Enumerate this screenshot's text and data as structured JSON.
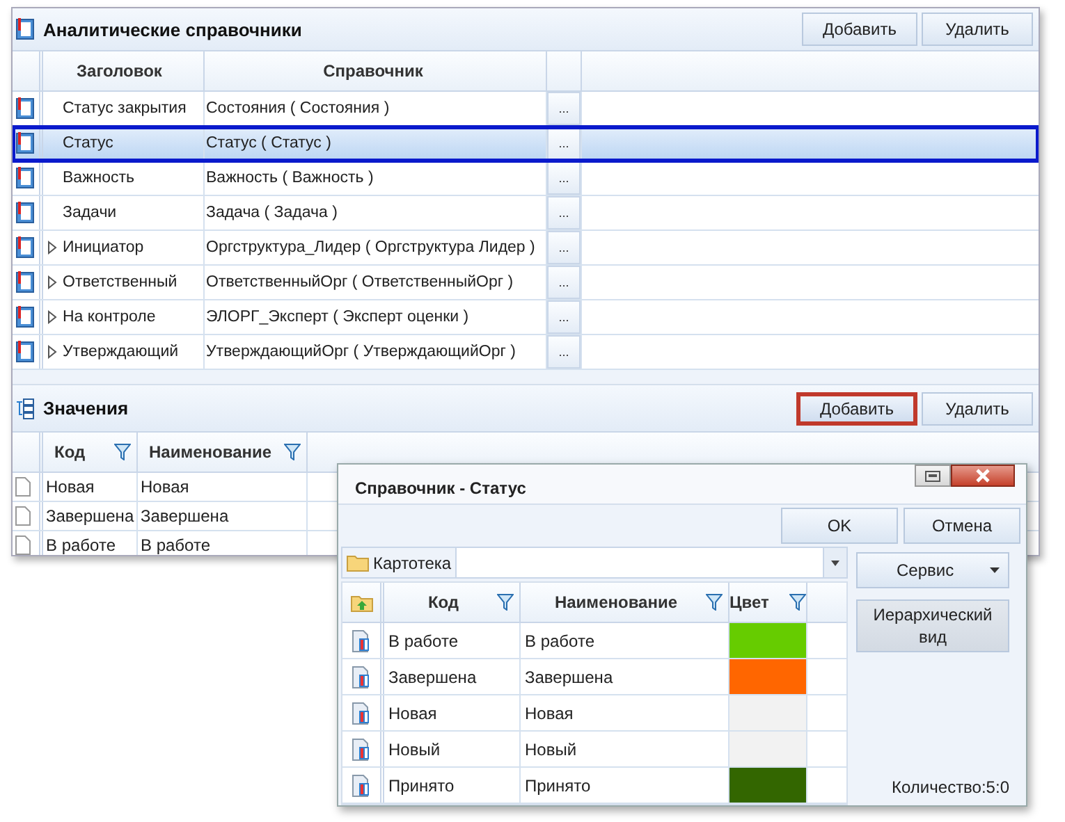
{
  "main_panel": {
    "title": "Аналитические справочники",
    "buttons": [
      "Добавить",
      "Удалить"
    ],
    "columns": [
      "Заголовок",
      "Справочник"
    ],
    "rows": [
      {
        "title": "Статус закрытия",
        "reference": "Состояния ( Состояния )",
        "button": "...",
        "expandable": false,
        "selected": false
      },
      {
        "title": "Статус",
        "reference": "Статус ( Статус )",
        "button": "...",
        "expandable": false,
        "selected": true
      },
      {
        "title": "Важность",
        "reference": "Важность ( Важность )",
        "button": "...",
        "expandable": false,
        "selected": false
      },
      {
        "title": "Задачи",
        "reference": "Задача ( Задача )",
        "button": "...",
        "expandable": false,
        "selected": false
      },
      {
        "title": "Инициатор",
        "reference": "Оргструктура_Лидер ( Оргструктура Лидер )",
        "button": "...",
        "expandable": true,
        "selected": false
      },
      {
        "title": "Ответственный",
        "reference": "ОтветственныйОрг ( ОтветственныйОрг )",
        "button": "...",
        "expandable": true,
        "selected": false
      },
      {
        "title": "На контроле",
        "reference": "ЭЛОРГ_Эксперт ( Эксперт оценки )",
        "button": "...",
        "expandable": true,
        "selected": false
      },
      {
        "title": "Утверждающий",
        "reference": "УтверждающийОрг ( УтверждающийОрг )",
        "button": "...",
        "expandable": true,
        "selected": false
      }
    ]
  },
  "values_panel": {
    "title": "Значения",
    "buttons": [
      {
        "label": "Добавить",
        "highlighted": true
      },
      {
        "label": "Удалить",
        "highlighted": false
      }
    ],
    "columns": [
      "Код",
      "Наименование"
    ],
    "rows": [
      {
        "code": "Новая",
        "name": "Новая"
      },
      {
        "code": "Завершена",
        "name": "Завершена"
      },
      {
        "code": "В работе",
        "name": "В работе"
      }
    ]
  },
  "dialog": {
    "title": "Справочник - Статус",
    "buttons": [
      "OK",
      "Отмена"
    ],
    "folder": "Картотека",
    "service_button": "Сервис",
    "hierarchy_button": "Иерархический вид",
    "columns": [
      "Код",
      "Наименование",
      "Цвет"
    ],
    "rows": [
      {
        "code": "В работе",
        "name": "В работе",
        "color": "#66cc00"
      },
      {
        "code": "Завершена",
        "name": "Завершена",
        "color": "#ff6600"
      },
      {
        "code": "Новая",
        "name": "Новая",
        "color": "#f2f2f2"
      },
      {
        "code": "Новый",
        "name": "Новый",
        "color": "#f2f2f2"
      },
      {
        "code": "Принято",
        "name": "Принято",
        "color": "#336600"
      }
    ],
    "count": "Количество:5:0"
  }
}
